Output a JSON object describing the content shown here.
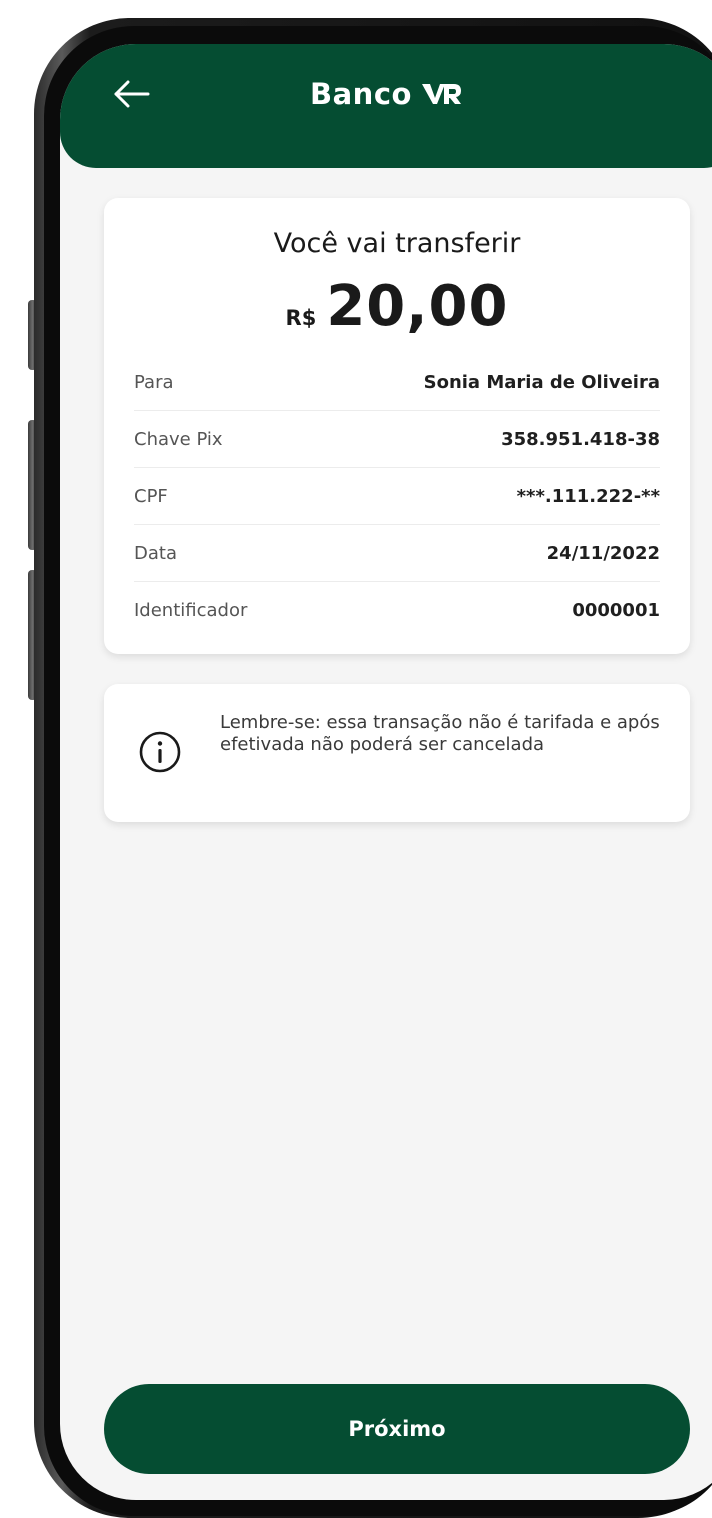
{
  "app": {
    "title": "Banco",
    "logo_icon": "vr-logo-icon",
    "back_icon": "arrow-left-icon"
  },
  "transfer": {
    "heading": "Você vai transferir",
    "currency": "R$",
    "amount": "20,00",
    "details": [
      {
        "label": "Para",
        "value": "Sonia Maria de Oliveira"
      },
      {
        "label": "Chave Pix",
        "value": "358.951.418-38"
      },
      {
        "label": "CPF",
        "value": "***.111.222-**"
      },
      {
        "label": "Data",
        "value": "24/11/2022"
      },
      {
        "label": "Identificador",
        "value": "0000001"
      }
    ]
  },
  "notice": {
    "icon": "info-icon",
    "text": "Lembre-se: essa transação não é tarifada e após efetivada não poderá ser cancelada"
  },
  "actions": {
    "next_label": "Próximo"
  },
  "colors": {
    "brand_green": "#054d32",
    "screen_background": "#f5f5f5",
    "card_background": "#ffffff"
  }
}
